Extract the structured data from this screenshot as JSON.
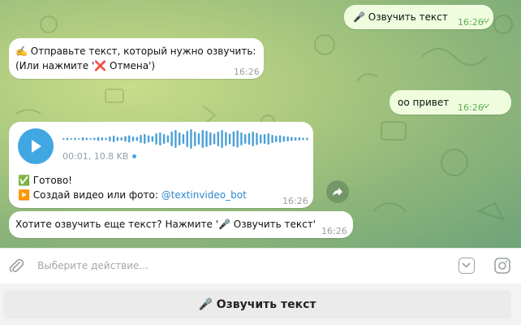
{
  "messages": {
    "m1": {
      "text": "🎤 Озвучить текст",
      "time": "16:26"
    },
    "m2": {
      "line1": "✍️ Отправьте текст, который нужно озвучить:",
      "line2": "(Или нажмите '❌ Отмена')",
      "time": "16:26"
    },
    "m3": {
      "text": "оо привет",
      "time": "16:26"
    },
    "m4": {
      "audio_meta": "00:01, 10.8 KB",
      "line1": "✅ Готово!",
      "line2_prefix": "▶️ Создай видео или фото: ",
      "line2_link": "@textinvideo_bot",
      "time": "16:26"
    },
    "m5": {
      "text": "Хотите озвучить еще текст? Нажмите '🎤 Озвучить текст'",
      "time": "16:26"
    }
  },
  "input": {
    "placeholder": "Выберите действие..."
  },
  "keyboard": {
    "button_label": "🎤 Озвучить текст"
  },
  "icons": {
    "attach": "paperclip-icon",
    "keyboard_toggle": "chevron-down-icon",
    "camera": "instagram-camera-icon",
    "play": "play-icon",
    "forward": "forward-arrow-icon",
    "read": "double-check-icon"
  },
  "colors": {
    "outgoing": "#effdde",
    "incoming": "#ffffff",
    "accent": "#40a7e3",
    "check": "#4fae4e"
  }
}
